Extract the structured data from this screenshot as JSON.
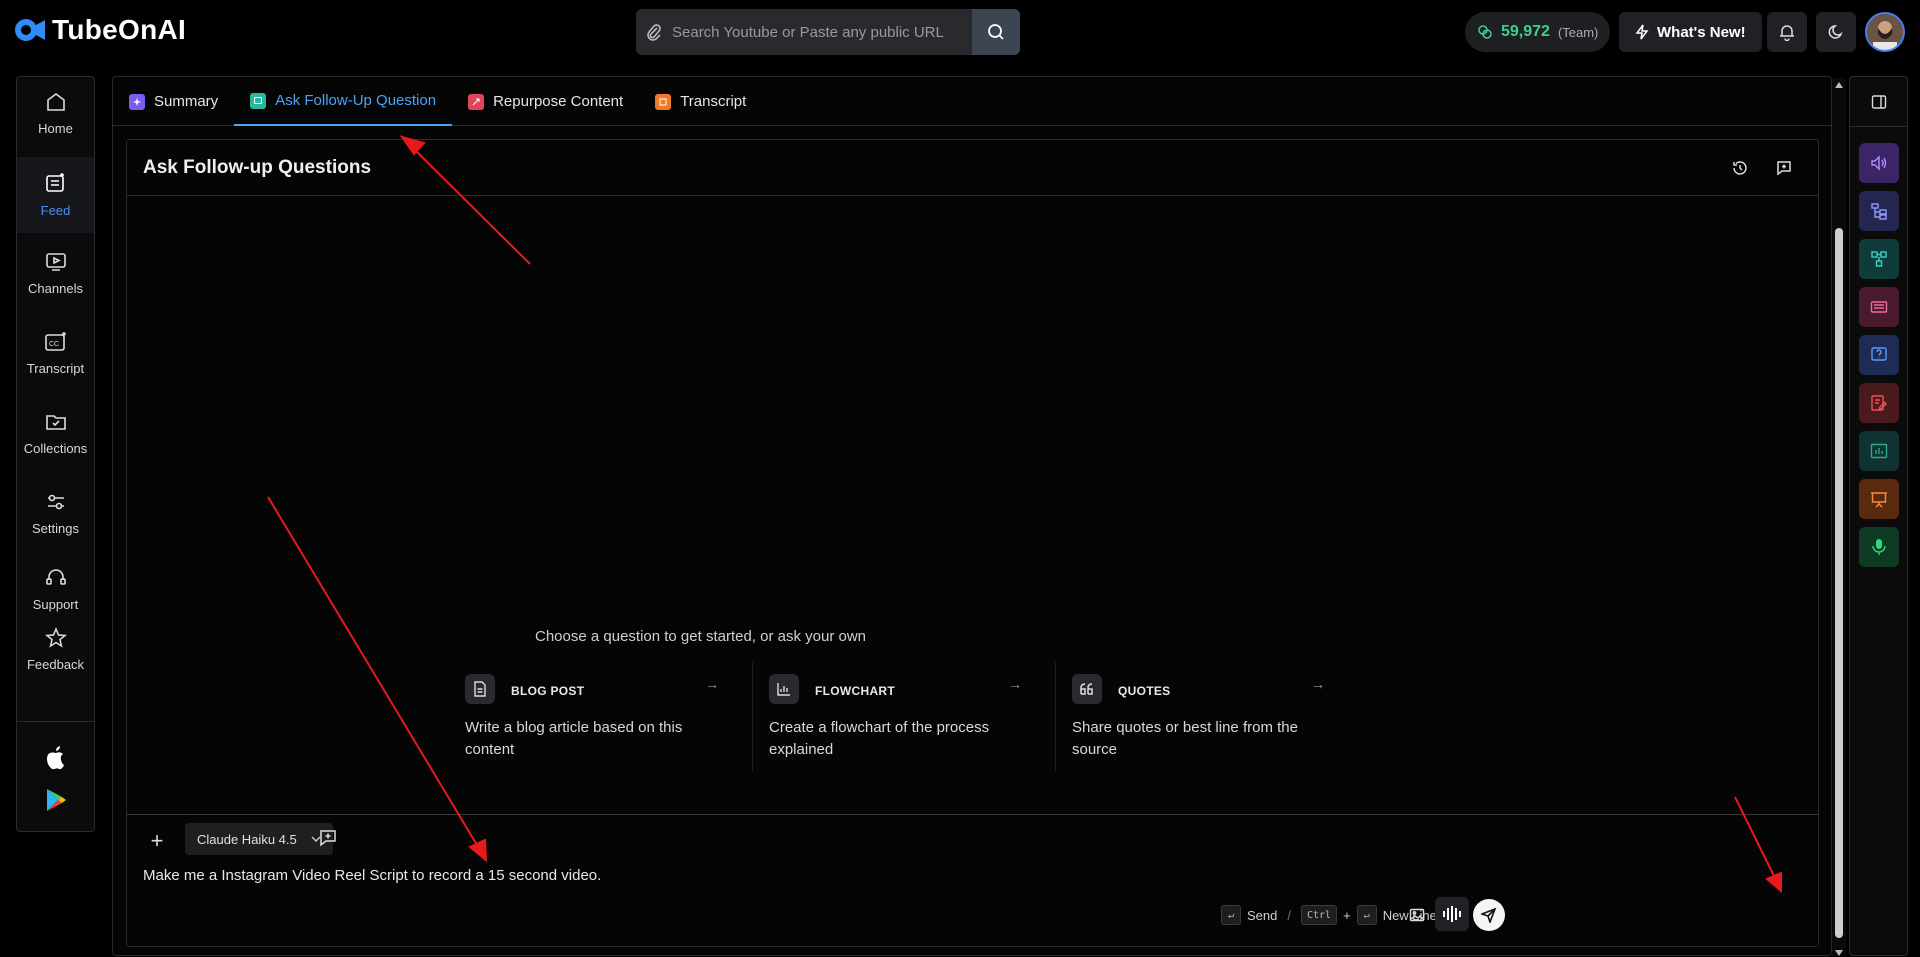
{
  "brand": {
    "name": "TubeOnAI"
  },
  "search": {
    "placeholder": "Search Youtube or Paste any public URL"
  },
  "header": {
    "credits": "59,972",
    "credits_plan": "(Team)",
    "whats_new": "What's New!"
  },
  "sidebar": {
    "items": [
      {
        "label": "Home",
        "icon": "home-icon"
      },
      {
        "label": "Feed",
        "icon": "feed-icon",
        "active": true
      },
      {
        "label": "Channels",
        "icon": "channels-icon"
      },
      {
        "label": "Transcript",
        "icon": "cc-icon"
      },
      {
        "label": "Collections",
        "icon": "folder-icon"
      },
      {
        "label": "Settings",
        "icon": "sliders-icon"
      },
      {
        "label": "Support",
        "icon": "headset-icon"
      },
      {
        "label": "Feedback",
        "icon": "star-icon"
      }
    ]
  },
  "tabs": [
    {
      "label": "Summary",
      "color": "#7b5cf0"
    },
    {
      "label": "Ask Follow-Up Question",
      "color": "#2ab7a0",
      "active": true
    },
    {
      "label": "Repurpose Content",
      "color": "#e0455a"
    },
    {
      "label": "Transcript",
      "color": "#f07a2a"
    }
  ],
  "chat": {
    "title": "Ask Follow-up Questions",
    "prompt_title": "Choose a question to get started, or ask your own",
    "cards": [
      {
        "title": "BLOG POST",
        "desc": "Write a blog article based on this content",
        "icon": "document-icon"
      },
      {
        "title": "FLOWCHART",
        "desc": "Create a flowchart of the process explained",
        "icon": "chart-icon"
      },
      {
        "title": "QUOTES",
        "desc": "Share quotes or best line from the source",
        "icon": "quote-icon"
      }
    ],
    "model": "Claude Haiku 4.5",
    "input_value": "Make me a Instagram Video Reel Script to record a 15 second video.",
    "hint_send": "Send",
    "hint_ctrl": "Ctrl",
    "hint_newline": "New Line"
  },
  "colors": {
    "accent": "#4aa3f5",
    "credits": "#3ecf8e",
    "annotation_arrow": "#e8191c"
  }
}
